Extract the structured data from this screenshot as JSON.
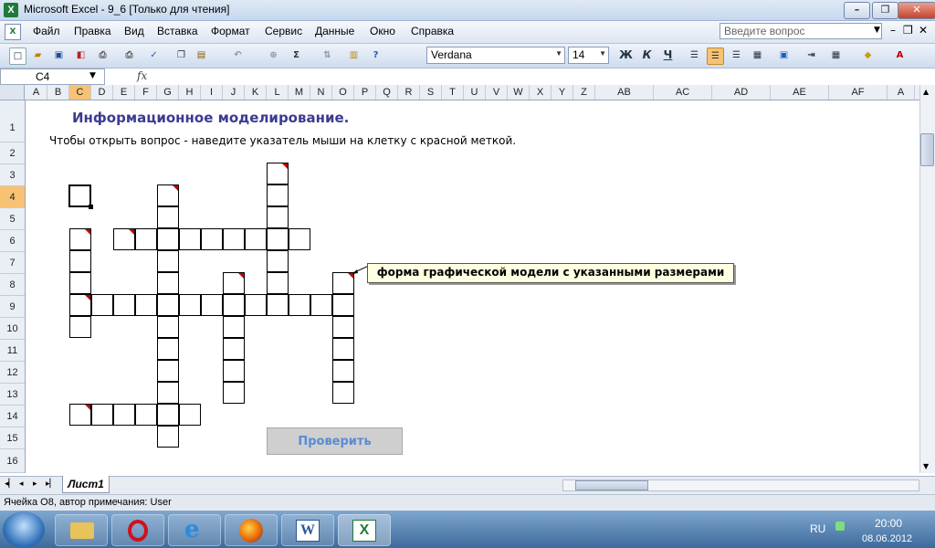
{
  "window": {
    "title": "Microsoft Excel - 9_6  [Только для чтения]"
  },
  "menu": {
    "items": [
      "Файл",
      "Правка",
      "Вид",
      "Вставка",
      "Формат",
      "Сервис",
      "Данные",
      "Окно",
      "Справка"
    ]
  },
  "help": {
    "placeholder": "Введите вопрос"
  },
  "toolbar": {
    "font": "Verdana",
    "size": "14",
    "bold": "Ж",
    "italic": "К",
    "underline": "Ч"
  },
  "formula": {
    "cell_ref": "C4",
    "fx": "fx"
  },
  "columns": [
    "A",
    "B",
    "C",
    "D",
    "E",
    "F",
    "G",
    "H",
    "I",
    "J",
    "K",
    "L",
    "M",
    "N",
    "O",
    "P",
    "Q",
    "R",
    "S",
    "T",
    "U",
    "V",
    "W",
    "X",
    "Y",
    "Z",
    "AB",
    "AC",
    "AD",
    "AE",
    "AF",
    "A"
  ],
  "selected_column": "C",
  "rows": [
    "1",
    "2",
    "3",
    "4",
    "5",
    "6",
    "7",
    "8",
    "9",
    "10",
    "11",
    "12",
    "13",
    "14",
    "15",
    "16"
  ],
  "selected_row": "4",
  "sheet": {
    "title": "Информационное моделирование.",
    "instruction": "Чтобы открыть вопрос - наведите указатель мыши на клетку с красной меткой.",
    "comment": "форма графической модели с указанными размерами",
    "check_button": "Проверить"
  },
  "tabs": {
    "sheet1": "Лист1"
  },
  "status": {
    "text": "Ячейка O8, автор примечания: User"
  },
  "taskbar": {
    "lang": "RU",
    "time": "20:00",
    "date": "08.06.2012"
  },
  "colors": {
    "accent_title": "#3b3b92",
    "marker": "#c00000",
    "comment_bg": "#ffffe1"
  }
}
